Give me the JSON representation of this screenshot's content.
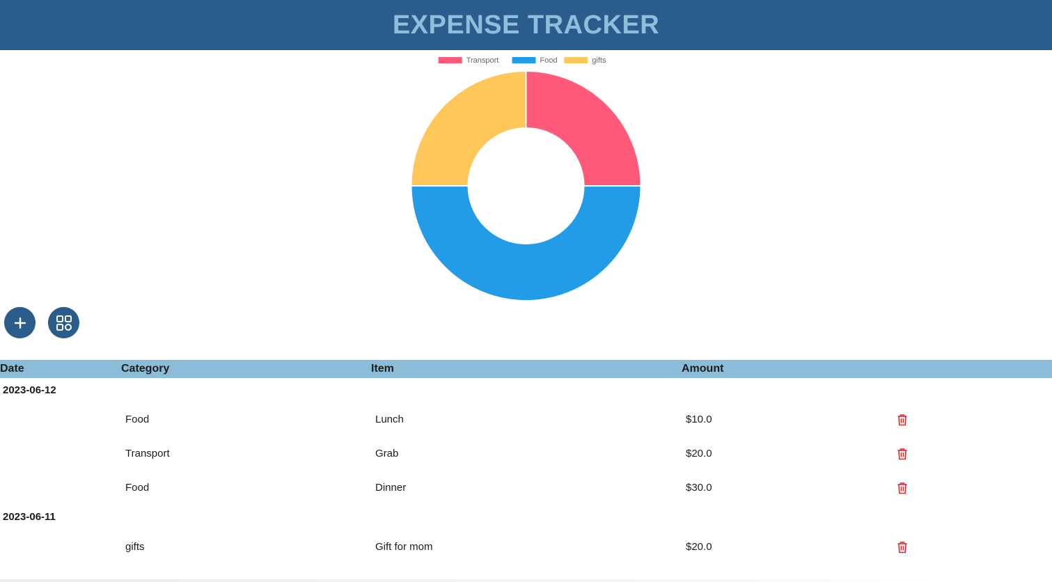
{
  "app": {
    "title": "EXPENSE TRACKER"
  },
  "colors": {
    "header_bg": "#2a5d8c",
    "title_text": "#8dbfdc",
    "table_header_bg": "#8cbdd8",
    "transport": "#ff5a7a",
    "food": "#229ce6",
    "gifts": "#ffc65a",
    "delete_icon": "#e0262f"
  },
  "chart_data": {
    "type": "pie",
    "variant": "doughnut",
    "legend": "top",
    "categories": [
      "Transport",
      "Food",
      "gifts"
    ],
    "values": [
      20.0,
      40.0,
      20.0
    ],
    "colors": [
      "#ff5a7a",
      "#229ce6",
      "#ffc65a"
    ]
  },
  "actions": {
    "add_icon": "plus-icon",
    "grid_icon": "grid-icon"
  },
  "table": {
    "headers": [
      "Date",
      "Category",
      "Item",
      "Amount"
    ],
    "groups": [
      {
        "date": "2023-06-12",
        "rows": [
          {
            "category": "Food",
            "item": "Lunch",
            "amount": "$10.0",
            "icon": "trash-icon"
          },
          {
            "category": "Transport",
            "item": "Grab",
            "amount": "$20.0",
            "icon": "trash-icon"
          },
          {
            "category": "Food",
            "item": "Dinner",
            "amount": "$30.0",
            "icon": "trash-icon"
          }
        ]
      },
      {
        "date": "2023-06-11",
        "rows": [
          {
            "category": "gifts",
            "item": "Gift for mom",
            "amount": "$20.0",
            "icon": "trash-icon"
          }
        ]
      }
    ]
  }
}
